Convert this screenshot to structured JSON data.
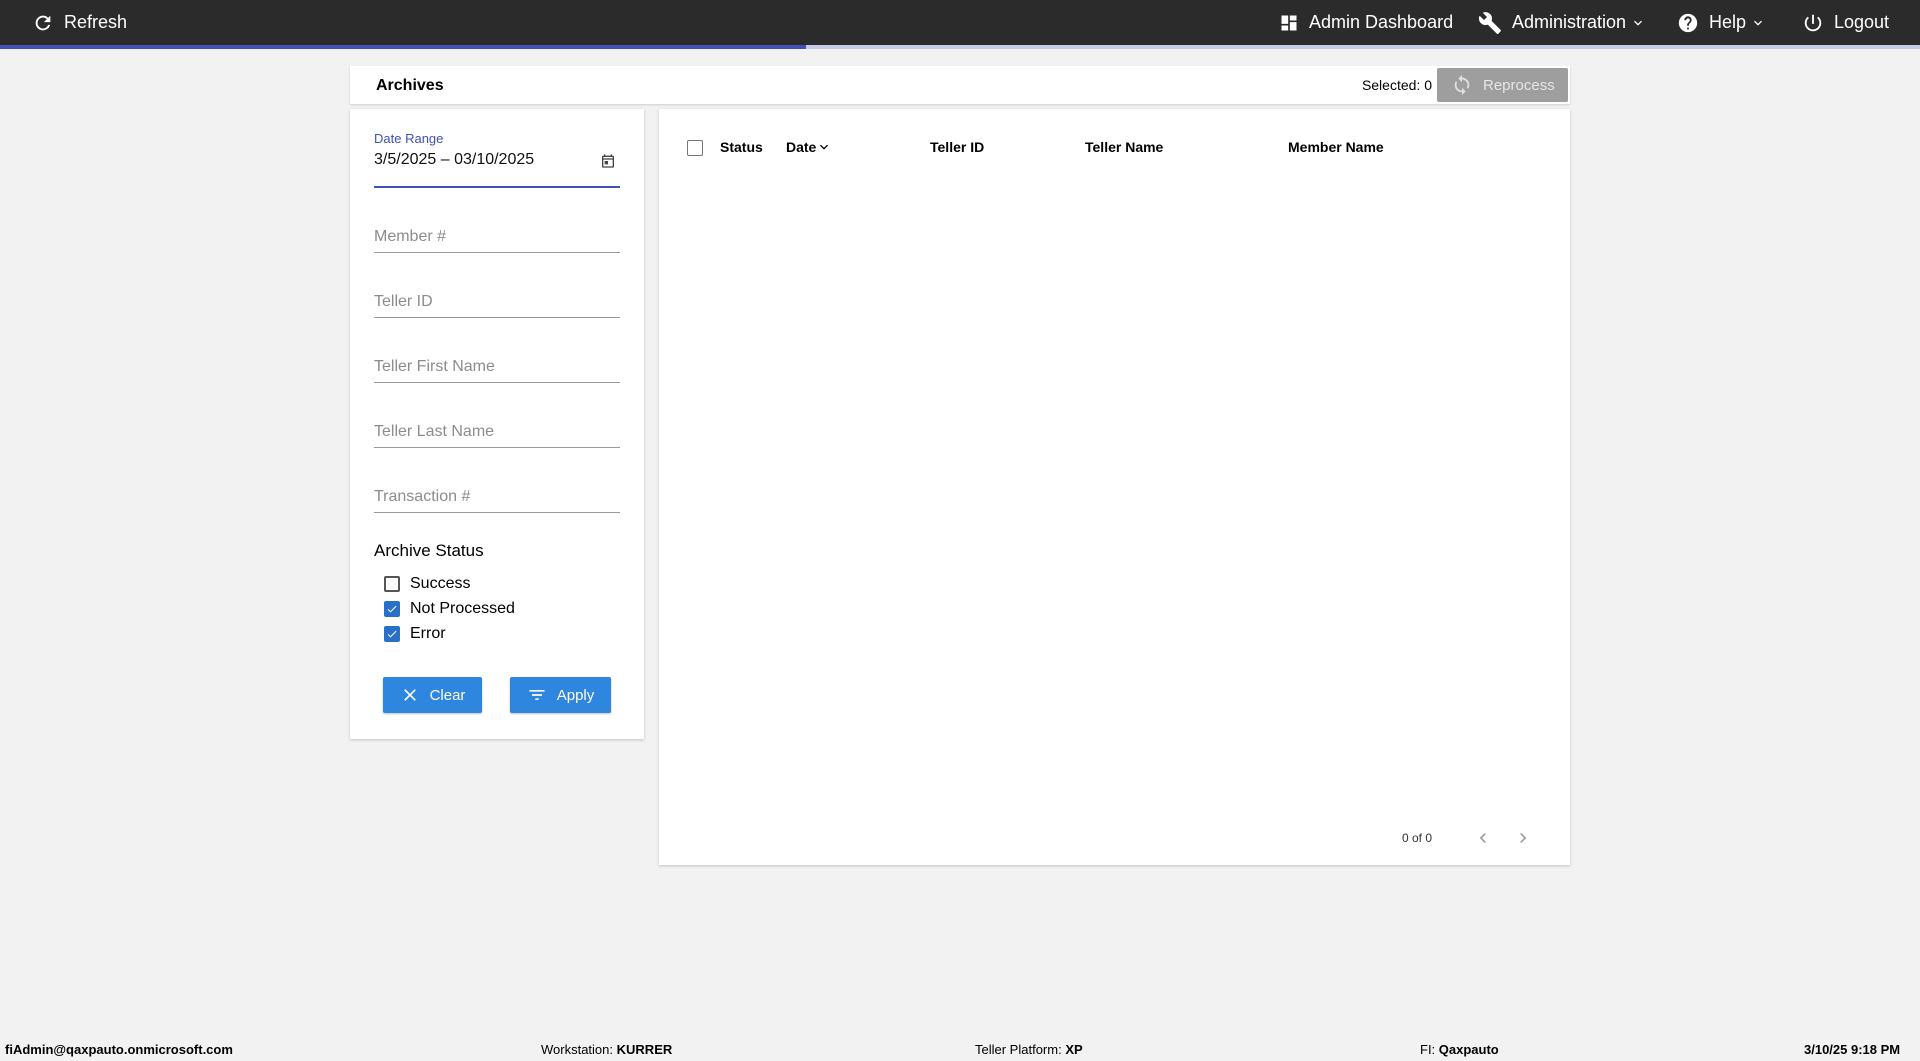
{
  "topbar": {
    "refresh_label": "Refresh",
    "admin_dashboard_label": "Admin Dashboard",
    "administration_label": "Administration",
    "help_label": "Help",
    "logout_label": "Logout",
    "progress_percent": 42
  },
  "header": {
    "title": "Archives",
    "selected_label": "Selected: 0",
    "reprocess_label": "Reprocess"
  },
  "filters": {
    "date_range_label": "Date Range",
    "date_range_value": "3/5/2025 – 03/10/2025",
    "member_placeholder": "Member #",
    "teller_id_placeholder": "Teller ID",
    "teller_first_name_placeholder": "Teller First Name",
    "teller_last_name_placeholder": "Teller Last Name",
    "transaction_placeholder": "Transaction #",
    "archive_status_title": "Archive Status",
    "statuses": [
      {
        "label": "Success",
        "checked": false
      },
      {
        "label": "Not Processed",
        "checked": true
      },
      {
        "label": "Error",
        "checked": true
      }
    ],
    "clear_label": "Clear",
    "apply_label": "Apply"
  },
  "table": {
    "columns": [
      "Status",
      "Date",
      "Teller ID",
      "Teller Name",
      "Member Name"
    ],
    "rows": [],
    "pager_text": "0 of 0"
  },
  "footer": {
    "user": "fiAdmin@qaxpauto.onmicrosoft.com",
    "workstation_label": "Workstation:",
    "workstation_value": "KURRER",
    "platform_label": "Teller Platform:",
    "platform_value": "XP",
    "fi_label": "FI:",
    "fi_value": "Qaxpauto",
    "datetime": "3/10/25 9:18 PM"
  },
  "colors": {
    "topbar_bg": "#2b2b2b",
    "accent": "#3f51b5",
    "button_blue": "#2e86de",
    "checkbox_blue": "#2a70c9"
  }
}
